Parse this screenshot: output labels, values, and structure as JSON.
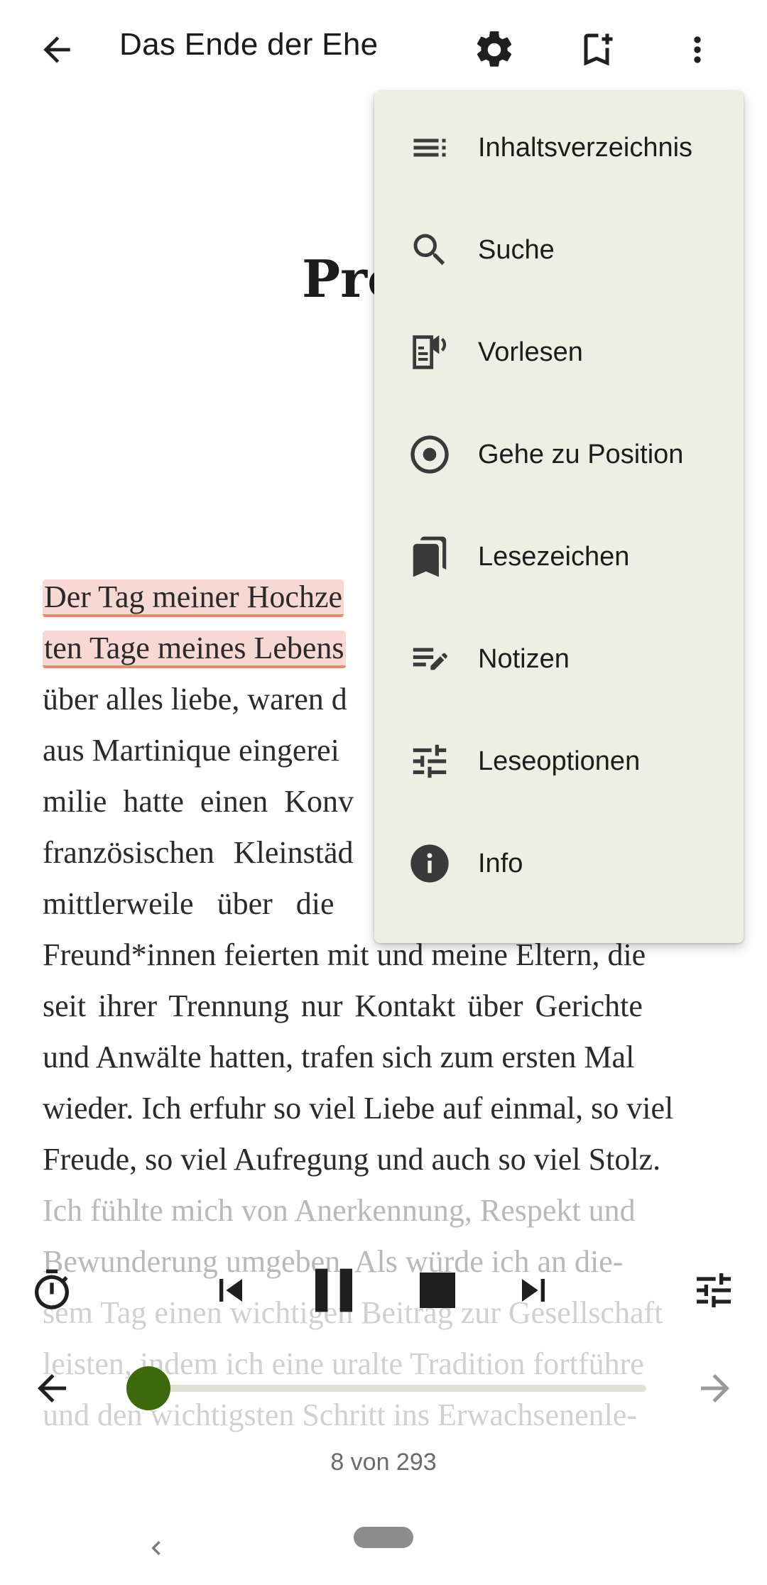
{
  "app_bar": {
    "title": "Das Ende der Ehe",
    "icons": [
      "back-arrow-icon",
      "settings-gear-icon",
      "add-bookmark-icon",
      "more-vert-icon"
    ]
  },
  "chapter": {
    "title": "Pro"
  },
  "book_text": {
    "lines": [
      "Der Tag meiner Hochze",
      "ten Tage meines Lebens",
      "über alles liebe, waren d",
      "aus Martinique eingerei",
      "milie hatte einen Konv",
      "französischen Kleinstäd",
      "mittlerweile über die",
      "Freund*innen feierten mit und meine Eltern, die",
      "seit ihrer Trennung nur Kontakt über Gerichte",
      "und Anwälte hatten, trafen sich zum ersten Mal",
      "wieder. Ich erfuhr so viel Liebe auf einmal, so viel",
      "Freude, so viel Aufregung und auch so viel Stolz.",
      "Ich fühlte mich von Anerkennung, Respekt und",
      "Bewunderung umgeben. Als würde ich an die-",
      "sem Tag einen wichtigen Beitrag zur Gesellschaft",
      "leisten, indem ich eine uralte Tradition fortführe",
      "und den wichtigsten Schritt ins Erwachsenenle-"
    ]
  },
  "menu": {
    "items": [
      {
        "label": "Inhaltsverzeichnis",
        "icon": "toc-icon"
      },
      {
        "label": "Suche",
        "icon": "search-icon"
      },
      {
        "label": "Vorlesen",
        "icon": "read-aloud-icon"
      },
      {
        "label": "Gehe zu Position",
        "icon": "goto-position-icon"
      },
      {
        "label": "Lesezeichen",
        "icon": "bookmarks-icon"
      },
      {
        "label": "Notizen",
        "icon": "notes-icon"
      },
      {
        "label": "Leseoptionen",
        "icon": "reading-options-icon"
      },
      {
        "label": "Info",
        "icon": "info-icon"
      }
    ]
  },
  "player": {
    "icons": [
      "timer-icon",
      "skip-previous-icon",
      "pause-icon",
      "stop-icon",
      "skip-next-icon",
      "tune-icon"
    ]
  },
  "page_navigation": {
    "position_fraction": 0.027,
    "counter_text": "8 von 293"
  },
  "colors": {
    "accent": "#3c6a0b",
    "menu_bg": "#eeefe4",
    "highlight_bg": "#f7d8d3",
    "highlight_underline": "#e78b6d"
  }
}
